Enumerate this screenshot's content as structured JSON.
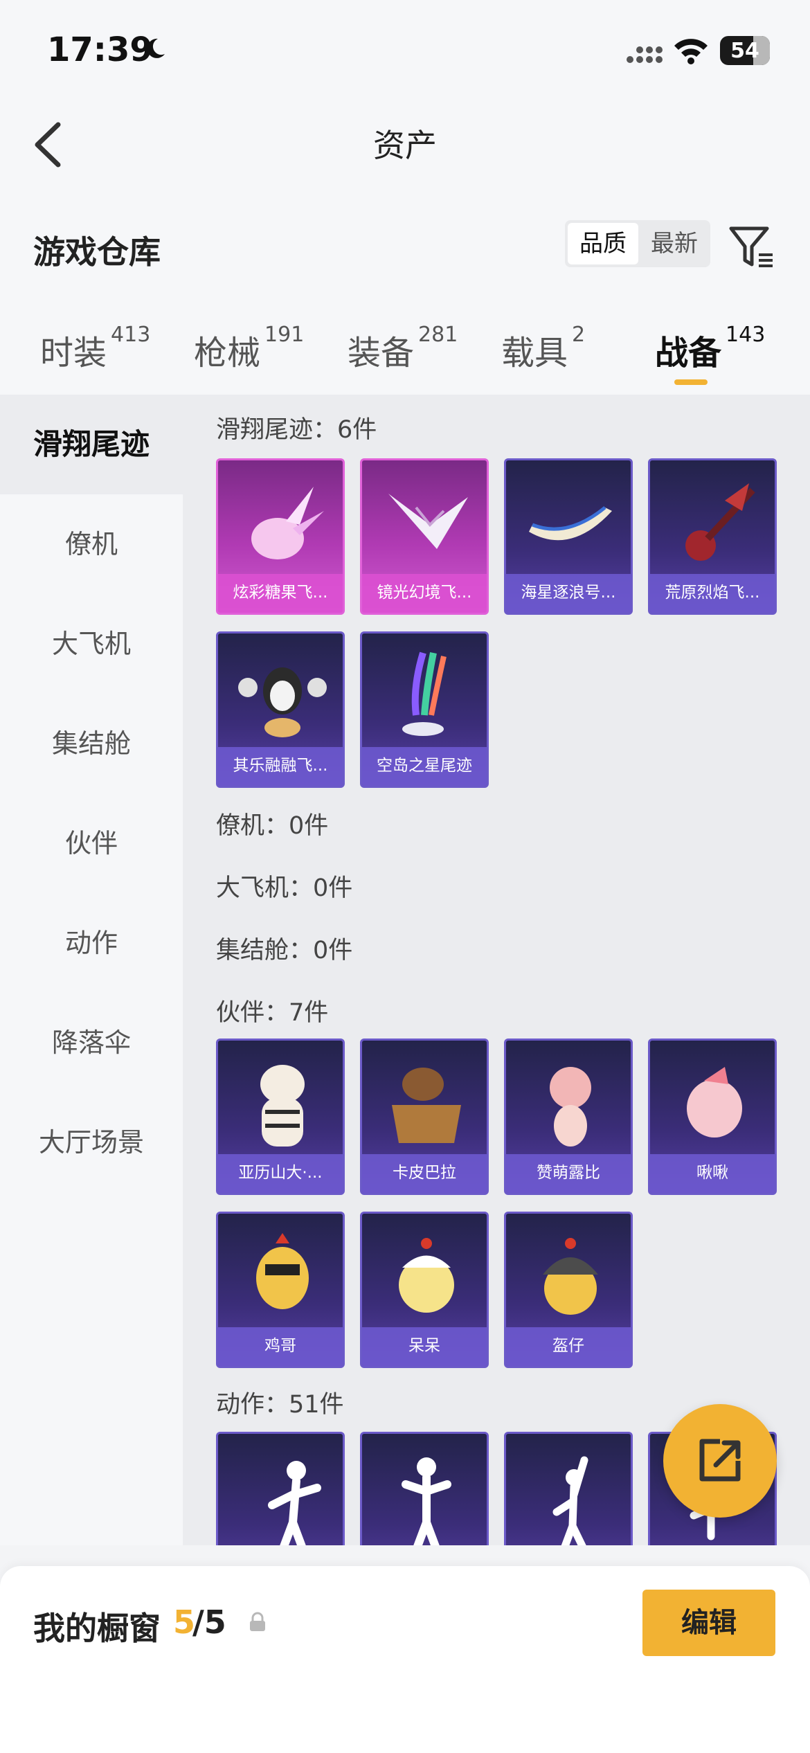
{
  "status": {
    "time": "17:39",
    "battery": "54"
  },
  "header": {
    "title": "资产"
  },
  "warehouse": {
    "title": "游戏仓库",
    "sort_quality": "品质",
    "sort_latest": "最新"
  },
  "tabs": [
    {
      "label": "时装",
      "count": "413"
    },
    {
      "label": "枪械",
      "count": "191"
    },
    {
      "label": "装备",
      "count": "281"
    },
    {
      "label": "载具",
      "count": "2"
    },
    {
      "label": "战备",
      "count": "143"
    }
  ],
  "sidebar": [
    "滑翔尾迹",
    "僚机",
    "大飞机",
    "集结舱",
    "伙伴",
    "动作",
    "降落伞",
    "大厅场景"
  ],
  "sections": {
    "glide": {
      "label": "滑翔尾迹：6件",
      "items": [
        "炫彩糖果飞...",
        "镜光幻境飞...",
        "海星逐浪号...",
        "荒原烈焰飞...",
        "其乐融融飞...",
        "空岛之星尾迹"
      ]
    },
    "wingman": {
      "label": "僚机：0件"
    },
    "bigplane": {
      "label": "大飞机：0件"
    },
    "pod": {
      "label": "集结舱：0件"
    },
    "partner": {
      "label": "伙伴：7件",
      "items": [
        "亚历山大·...",
        "卡皮巴拉",
        "赞萌露比",
        "啾啾",
        "鸡哥",
        "呆呆",
        "盔仔"
      ]
    },
    "action": {
      "label": "动作：51件"
    }
  },
  "bottom": {
    "label": "我的橱窗",
    "current": "5",
    "total": "/5",
    "edit": "编辑"
  },
  "colors": {
    "accent": "#f2b233",
    "card": "#3b2d79",
    "card_pink": "#b03ab3"
  }
}
